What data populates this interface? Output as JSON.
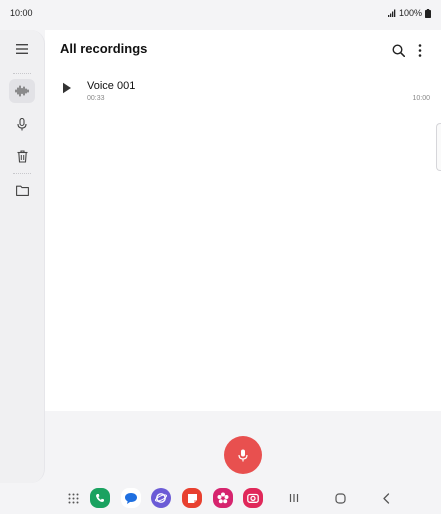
{
  "status_bar": {
    "time": "10:00",
    "battery": "100%"
  },
  "sidebar": {
    "items": [
      {
        "name": "menu-icon"
      },
      {
        "name": "waveform-icon",
        "active": true
      },
      {
        "name": "microphone-icon"
      },
      {
        "name": "trash-icon"
      },
      {
        "name": "folder-icon"
      }
    ]
  },
  "header": {
    "title": "All recordings",
    "actions": [
      "search-icon",
      "more-options-icon"
    ]
  },
  "recordings": [
    {
      "name": "Voice 001",
      "duration": "00:33",
      "time": "10:00"
    }
  ],
  "record_button": {
    "icon": "microphone-icon",
    "color": "#e8504f"
  },
  "navbar": {
    "apps": [
      {
        "name": "apps-grid-icon"
      },
      {
        "name": "phone-app-icon",
        "color": "#1aa260"
      },
      {
        "name": "messages-app-icon",
        "color": "#1f6fe0"
      },
      {
        "name": "internet-app-icon",
        "color": "#6b5bd6"
      },
      {
        "name": "notes-app-icon",
        "color": "#e8402f"
      },
      {
        "name": "gallery-app-icon",
        "color": "#d6246e"
      },
      {
        "name": "camera-app-icon",
        "color": "#e0285a"
      }
    ],
    "system": [
      "recents-icon",
      "home-icon",
      "back-icon"
    ]
  }
}
